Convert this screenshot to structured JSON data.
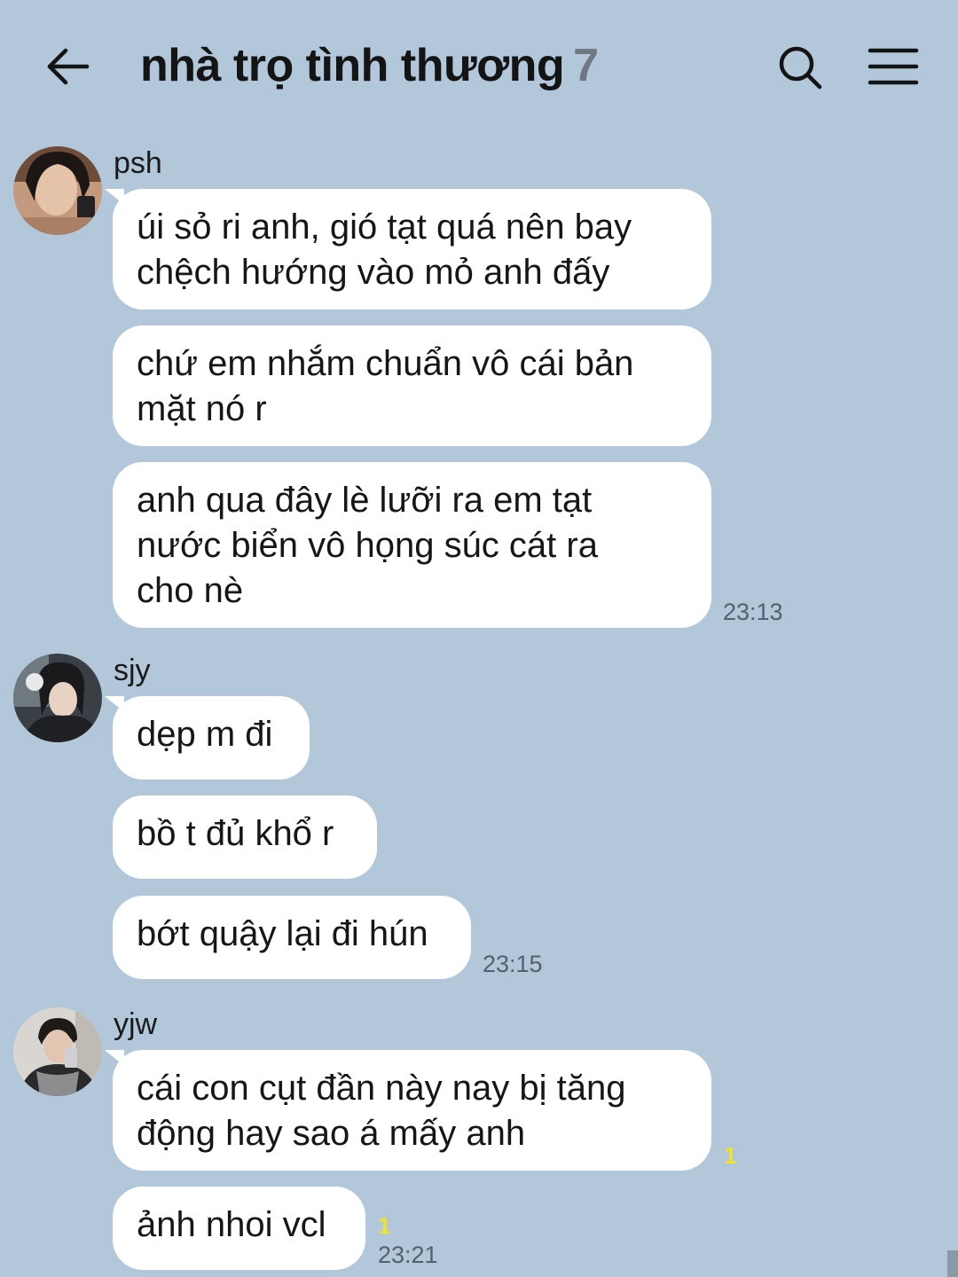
{
  "header": {
    "back_icon": "arrow-left-icon",
    "title": "nhà trọ tình thương",
    "member_count": "7",
    "search_icon": "search-icon",
    "menu_icon": "hamburger-menu-icon"
  },
  "groups": [
    {
      "sender": "psh",
      "messages": [
        "úi sỏ ri anh, gió tạt quá nên bay\nchệch hướng vào mỏ anh đấy",
        "chứ em nhắm chuẩn vô cái bản\nmặt nó r",
        "anh qua đây lè lưỡi ra em tạt\nnước biển vô họng súc cát ra\ncho nè"
      ],
      "time": "23:13"
    },
    {
      "sender": "sjy",
      "messages": [
        "dẹp m đi",
        "bồ t đủ khổ r",
        "bớt quậy lại đi hún"
      ],
      "time": "23:15"
    },
    {
      "sender": "yjw",
      "messages": [
        "cái con cụt đần này nay bị tăng\nđộng hay sao á mấy anh",
        "ảnh nhoi vcl"
      ],
      "unread": [
        "1",
        "1"
      ],
      "time": "23:21"
    }
  ],
  "colors": {
    "background": "#b2c7da",
    "bubble": "#ffffff",
    "unread": "#f1e22c"
  }
}
